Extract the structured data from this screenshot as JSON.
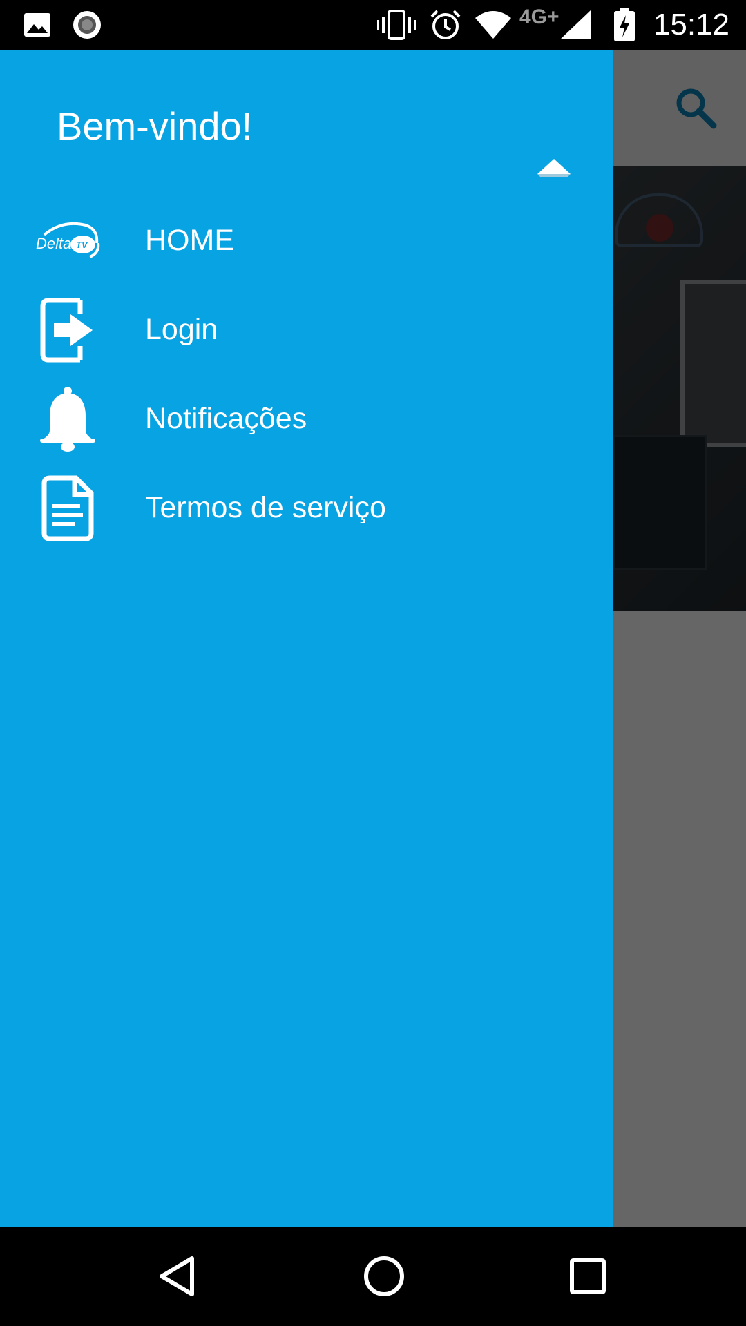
{
  "status_bar": {
    "network_type": "4G+",
    "time": "15:12"
  },
  "drawer": {
    "title": "Bem-vindo!",
    "background_color": "#08a3e3",
    "items": [
      {
        "label": "HOME",
        "icon": "deltatv-logo-icon"
      },
      {
        "label": "Login",
        "icon": "login-icon"
      },
      {
        "label": "Notificações",
        "icon": "bell-icon"
      },
      {
        "label": "Termos de serviço",
        "icon": "document-icon"
      }
    ]
  },
  "app": {
    "toolbar_icon": "search-icon",
    "accent_color": "#0a86b9"
  },
  "nav_bar": {
    "buttons": [
      "back-icon",
      "home-icon",
      "recents-icon"
    ]
  }
}
